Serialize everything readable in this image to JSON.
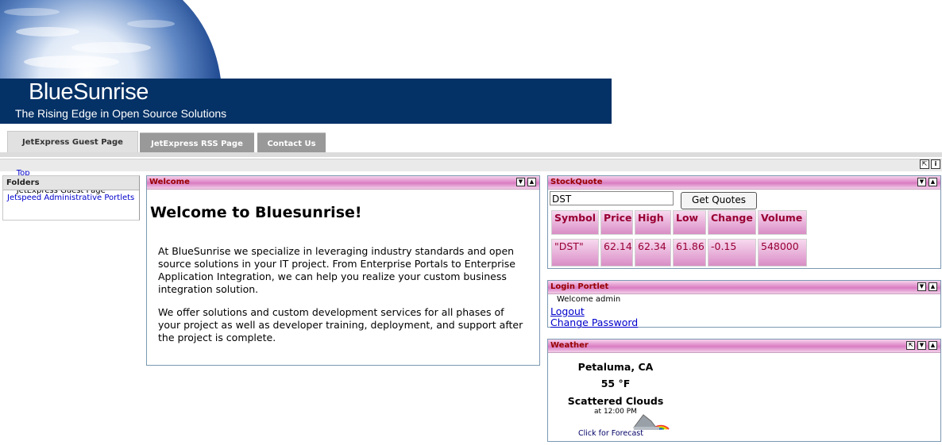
{
  "banner": {
    "title": "BlueSunrise",
    "tagline": "The Rising Edge in Open Source Solutions",
    "colors": {
      "brandbar": "#043166",
      "sky": "#2b5aa3"
    }
  },
  "tabs": [
    {
      "label": "JetExpress Guest Page",
      "active": true
    },
    {
      "label": "JetExpress RSS Page",
      "active": false
    },
    {
      "label": "Contact Us",
      "active": false
    }
  ],
  "breadcrumb": {
    "top": "Top",
    "separator": ">>",
    "current": "JetExpress Guest Page"
  },
  "folders": {
    "title": "Folders",
    "link": "Jetspeed Administrative Portlets"
  },
  "welcome": {
    "title": "Welcome",
    "heading": "Welcome to Bluesunrise!",
    "p1": "At BlueSunrise we specialize in leveraging industry standards and open source solutions in your IT project. From Enterprise Portals to Enterprise Application Integration, we can help you realize your custom business integration solution.",
    "p2": "We offer solutions and custom development services for all phases of your project as well as developer training, deployment, and support after the project is complete."
  },
  "stock": {
    "title": "StockQuote",
    "input_value": "DST",
    "button": "Get Quotes",
    "columns": [
      "Symbol",
      "Price",
      "High",
      "Low",
      "Change",
      "Volume"
    ],
    "row": [
      "\"DST\"",
      "62.14",
      "62.34",
      "61.86",
      "-0.15",
      "548000"
    ]
  },
  "login": {
    "title": "Login Portlet",
    "welcome": "Welcome admin",
    "logout": "Logout",
    "change_password": "Change Password"
  },
  "weather": {
    "title": "Weather",
    "city": "Petaluma, CA",
    "temp": "55 °F",
    "condition": "Scattered Clouds",
    "time": "at 12:00 PM",
    "link": "Click for Forecast",
    "icon": "partly-cloudy-rainbow-icon"
  },
  "icons": {
    "restore": "restore-icon",
    "info": "info-icon",
    "minimize": "minimize-icon",
    "maximize": "maximize-icon"
  }
}
